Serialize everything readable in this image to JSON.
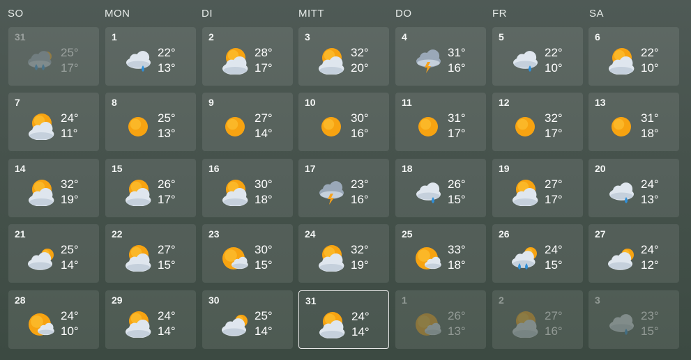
{
  "weekdays": [
    "SO",
    "MON",
    "DI",
    "MITT",
    "DO",
    "FR",
    "SA"
  ],
  "weeks": [
    [
      {
        "day": "31",
        "high": "25°",
        "low": "17°",
        "icon": "rain-icon",
        "muted": true
      },
      {
        "day": "1",
        "high": "22°",
        "low": "13°",
        "icon": "cloud-rain-icon"
      },
      {
        "day": "2",
        "high": "28°",
        "low": "17°",
        "icon": "partly-cloudy-icon"
      },
      {
        "day": "3",
        "high": "32°",
        "low": "20°",
        "icon": "partly-cloudy-icon"
      },
      {
        "day": "4",
        "high": "31°",
        "low": "16°",
        "icon": "thunderstorm-icon"
      },
      {
        "day": "5",
        "high": "22°",
        "low": "10°",
        "icon": "cloud-rain-icon"
      },
      {
        "day": "6",
        "high": "22°",
        "low": "10°",
        "icon": "partly-cloudy-icon"
      }
    ],
    [
      {
        "day": "7",
        "high": "24°",
        "low": "11°",
        "icon": "partly-cloudy-icon"
      },
      {
        "day": "8",
        "high": "25°",
        "low": "13°",
        "icon": "sun-icon"
      },
      {
        "day": "9",
        "high": "27°",
        "low": "14°",
        "icon": "sun-icon"
      },
      {
        "day": "10",
        "high": "30°",
        "low": "16°",
        "icon": "sun-icon"
      },
      {
        "day": "11",
        "high": "31°",
        "low": "17°",
        "icon": "sun-icon"
      },
      {
        "day": "12",
        "high": "32°",
        "low": "17°",
        "icon": "sun-icon"
      },
      {
        "day": "13",
        "high": "31°",
        "low": "18°",
        "icon": "sun-icon"
      }
    ],
    [
      {
        "day": "14",
        "high": "32°",
        "low": "19°",
        "icon": "partly-cloudy-icon"
      },
      {
        "day": "15",
        "high": "26°",
        "low": "17°",
        "icon": "partly-cloudy-icon"
      },
      {
        "day": "16",
        "high": "30°",
        "low": "18°",
        "icon": "partly-cloudy-icon"
      },
      {
        "day": "17",
        "high": "23°",
        "low": "16°",
        "icon": "thunderstorm-icon"
      },
      {
        "day": "18",
        "high": "26°",
        "low": "15°",
        "icon": "cloud-rain-icon"
      },
      {
        "day": "19",
        "high": "27°",
        "low": "17°",
        "icon": "partly-cloudy-icon"
      },
      {
        "day": "20",
        "high": "24°",
        "low": "13°",
        "icon": "cloud-rain-icon"
      }
    ],
    [
      {
        "day": "21",
        "high": "25°",
        "low": "14°",
        "icon": "mostly-cloudy-icon"
      },
      {
        "day": "22",
        "high": "27°",
        "low": "15°",
        "icon": "partly-cloudy-icon"
      },
      {
        "day": "23",
        "high": "30°",
        "low": "15°",
        "icon": "mostly-sunny-icon"
      },
      {
        "day": "24",
        "high": "32°",
        "low": "19°",
        "icon": "partly-cloudy-icon"
      },
      {
        "day": "25",
        "high": "33°",
        "low": "18°",
        "icon": "mostly-sunny-icon"
      },
      {
        "day": "26",
        "high": "24°",
        "low": "15°",
        "icon": "sun-rain-icon"
      },
      {
        "day": "27",
        "high": "24°",
        "low": "12°",
        "icon": "mostly-cloudy-icon"
      }
    ],
    [
      {
        "day": "28",
        "high": "24°",
        "low": "10°",
        "icon": "mostly-sunny-icon"
      },
      {
        "day": "29",
        "high": "24°",
        "low": "14°",
        "icon": "partly-cloudy-icon"
      },
      {
        "day": "30",
        "high": "25°",
        "low": "14°",
        "icon": "mostly-cloudy-icon"
      },
      {
        "day": "31",
        "high": "24°",
        "low": "14°",
        "icon": "partly-cloudy-icon",
        "today": true
      },
      {
        "day": "1",
        "high": "26°",
        "low": "13°",
        "icon": "mostly-sunny-icon",
        "muted": true
      },
      {
        "day": "2",
        "high": "27°",
        "low": "16°",
        "icon": "partly-cloudy-icon",
        "muted": true
      },
      {
        "day": "3",
        "high": "23°",
        "low": "15°",
        "icon": "cloud-rain-icon",
        "muted": true
      }
    ]
  ],
  "colors": {
    "sun": "#f7a311",
    "sun_light": "#ffc93a",
    "cloud": "#dfe6ee",
    "cloud_dark": "#9aa8b8",
    "rain": "#2f8fd8",
    "bolt": "#f6a21c",
    "today_border": "#e8e8e8"
  }
}
